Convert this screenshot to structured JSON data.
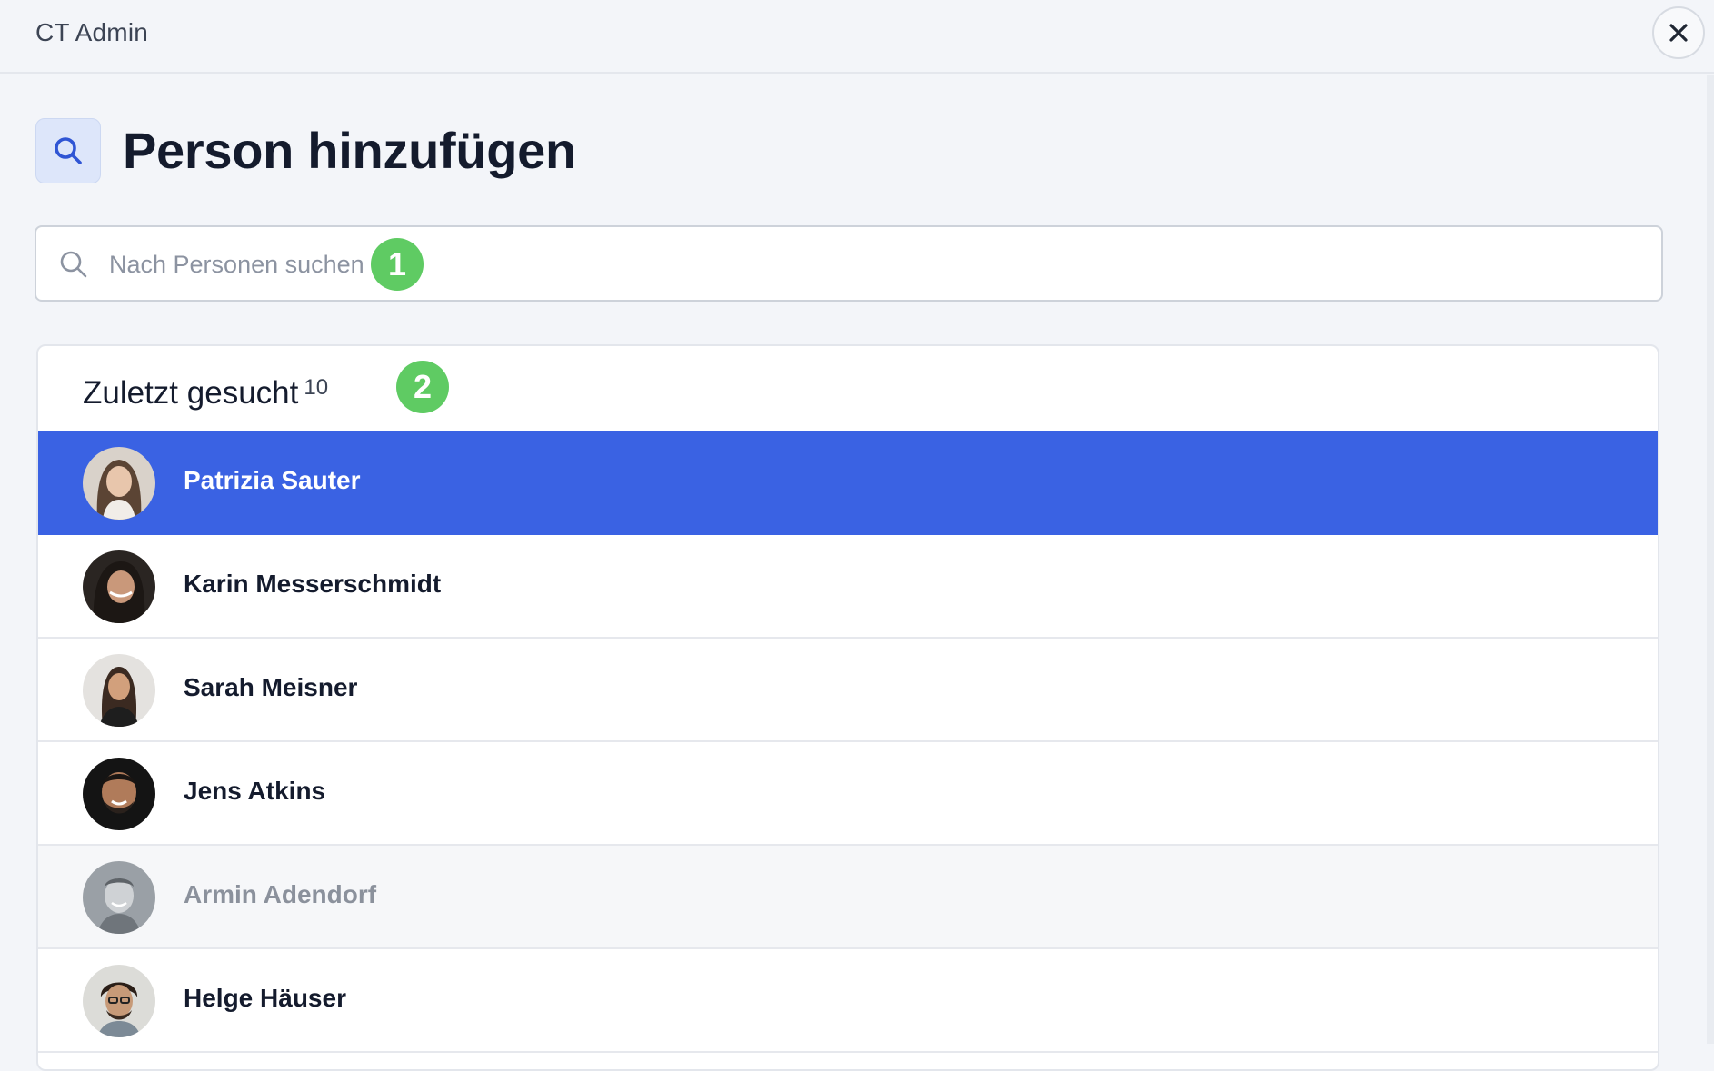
{
  "app": {
    "title": "CT Admin"
  },
  "header": {
    "title": "Person hinzufügen",
    "icon": "search-icon"
  },
  "search": {
    "placeholder": "Nach Personen suchen",
    "value": ""
  },
  "markers": [
    "1",
    "2"
  ],
  "tabs": [
    {
      "label": "Zuletzt gesucht",
      "count": "10",
      "active": true
    }
  ],
  "people": [
    {
      "name": "Patrizia Sauter",
      "state": "selected"
    },
    {
      "name": "Karin Messerschmidt",
      "state": "normal"
    },
    {
      "name": "Sarah Meisner",
      "state": "normal"
    },
    {
      "name": "Jens Atkins",
      "state": "normal"
    },
    {
      "name": "Armin Adendorf",
      "state": "inactive"
    },
    {
      "name": "Helge Häuser",
      "state": "normal"
    }
  ],
  "colors": {
    "accent": "#3a62e3",
    "marker": "#5fcb63",
    "background": "#f3f5f9"
  }
}
